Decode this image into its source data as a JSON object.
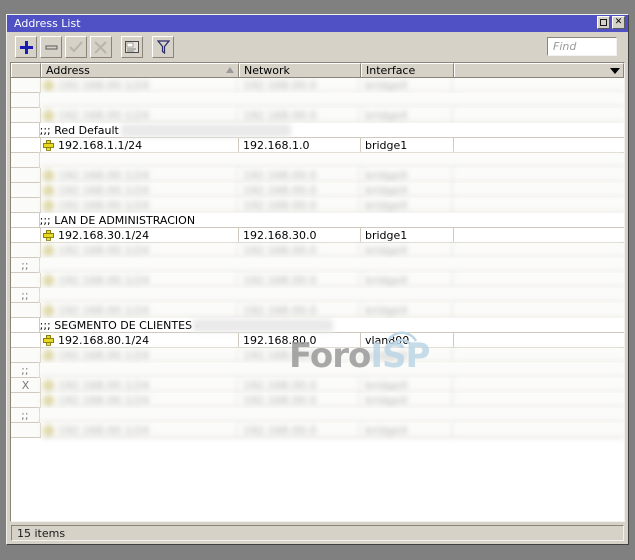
{
  "window": {
    "title": "Address List",
    "maximize_label": "□",
    "close_label": "✕"
  },
  "toolbar": {
    "buttons": [
      {
        "name": "add-button",
        "icon": "plus-icon",
        "label": "+",
        "enabled": true
      },
      {
        "name": "remove-button",
        "icon": "minus-icon",
        "label": "−",
        "enabled": true
      },
      {
        "name": "enable-button",
        "icon": "check-icon",
        "label": "✓",
        "enabled": false
      },
      {
        "name": "disable-button",
        "icon": "cross-check-icon",
        "label": "✗",
        "enabled": false
      },
      {
        "name": "comment-button",
        "icon": "comment-icon",
        "label": "",
        "enabled": true
      },
      {
        "name": "filter-button",
        "icon": "funnel-icon",
        "label": "",
        "enabled": true
      }
    ],
    "find": {
      "placeholder": "Find",
      "value": ""
    }
  },
  "table": {
    "columns": [
      {
        "key": "flags",
        "label": ""
      },
      {
        "key": "address",
        "label": "Address",
        "sorted": "asc"
      },
      {
        "key": "network",
        "label": "Network"
      },
      {
        "key": "interface",
        "label": "Interface"
      },
      {
        "key": "extra",
        "label": ""
      }
    ],
    "rows": [
      {
        "type": "data",
        "flags": "",
        "address": "",
        "network": "",
        "interface": "",
        "redacted": true
      },
      {
        "type": "comment",
        "comment": "",
        "redacted": true
      },
      {
        "type": "data",
        "flags": "",
        "address": "",
        "network": "",
        "interface": "",
        "redacted": true
      },
      {
        "type": "comment",
        "comment": ";;; Red Default",
        "redacted": false,
        "trail": true
      },
      {
        "type": "data",
        "flags": "",
        "address": "192.168.1.1/24",
        "network": "192.168.1.0",
        "interface": "bridge1",
        "redacted": false
      },
      {
        "type": "comment",
        "comment": "",
        "redacted": true
      },
      {
        "type": "data",
        "flags": "",
        "address": "",
        "network": "",
        "interface": "",
        "redacted": true
      },
      {
        "type": "data",
        "flags": "",
        "address": "",
        "network": "",
        "interface": "",
        "redacted": true
      },
      {
        "type": "data",
        "flags": "",
        "address": "",
        "network": "",
        "interface": "",
        "redacted": true
      },
      {
        "type": "comment",
        "comment": ";;; LAN DE ADMINISTRACION",
        "redacted": false,
        "trail": false
      },
      {
        "type": "data",
        "flags": "",
        "address": "192.168.30.1/24",
        "network": "192.168.30.0",
        "interface": "bridge1",
        "redacted": false
      },
      {
        "type": "data",
        "flags": "",
        "address": "",
        "network": "",
        "interface": "",
        "redacted": true
      },
      {
        "type": "comment",
        "comment": "",
        "flags": ";;",
        "redacted": true
      },
      {
        "type": "data",
        "flags": "",
        "address": "",
        "network": "",
        "interface": "",
        "redacted": true
      },
      {
        "type": "comment",
        "comment": "",
        "flags": ";;",
        "redacted": true
      },
      {
        "type": "data",
        "flags": "",
        "address": "",
        "network": "",
        "interface": "",
        "redacted": true
      },
      {
        "type": "comment",
        "comment": ";;; SEGMENTO DE CLIENTES -",
        "redacted": false,
        "trail": true
      },
      {
        "type": "data",
        "flags": "",
        "address": "192.168.80.1/24",
        "network": "192.168.80.0",
        "interface": "vlan800",
        "redacted": false
      },
      {
        "type": "data",
        "flags": "",
        "address": "",
        "network": "",
        "interface": "",
        "redacted": true
      },
      {
        "type": "comment",
        "comment": "",
        "flags": ";;",
        "redacted": true
      },
      {
        "type": "data",
        "flags": "X",
        "address": "",
        "network": "",
        "interface": "",
        "redacted": true
      },
      {
        "type": "data",
        "flags": "",
        "address": "",
        "network": "",
        "interface": "",
        "redacted": true
      },
      {
        "type": "comment",
        "comment": "",
        "flags": ";;",
        "redacted": true
      },
      {
        "type": "data",
        "flags": "",
        "address": "",
        "network": "",
        "interface": "",
        "redacted": true
      }
    ]
  },
  "watermark": {
    "text_primary": "Foro",
    "text_secondary": "ISP"
  },
  "statusbar": {
    "items_text": "15 items"
  },
  "colors": {
    "titlebar": "#4f51c4",
    "chrome": "#d6d2c8",
    "desktop": "#808080",
    "accent_icon": "#1a1ab4",
    "address_icon": "#e8d91f"
  }
}
